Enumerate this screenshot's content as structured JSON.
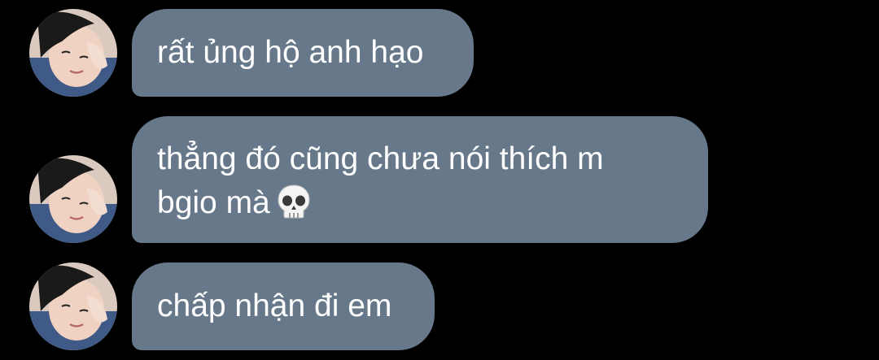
{
  "chat": {
    "messages": [
      {
        "lines": [
          "rất ủng hộ anh hạo"
        ],
        "avatar": "sender-avatar"
      },
      {
        "lines": [
          "thẳng đó cũng chưa nói thích m",
          "bgio mà"
        ],
        "emoji": "skull-emoji",
        "avatar": "sender-avatar"
      },
      {
        "lines": [
          "chấp nhận đi em"
        ],
        "avatar": "sender-avatar"
      }
    ]
  },
  "colors": {
    "background": "#000000",
    "bubble": "#66788a",
    "text": "#ffffff"
  }
}
